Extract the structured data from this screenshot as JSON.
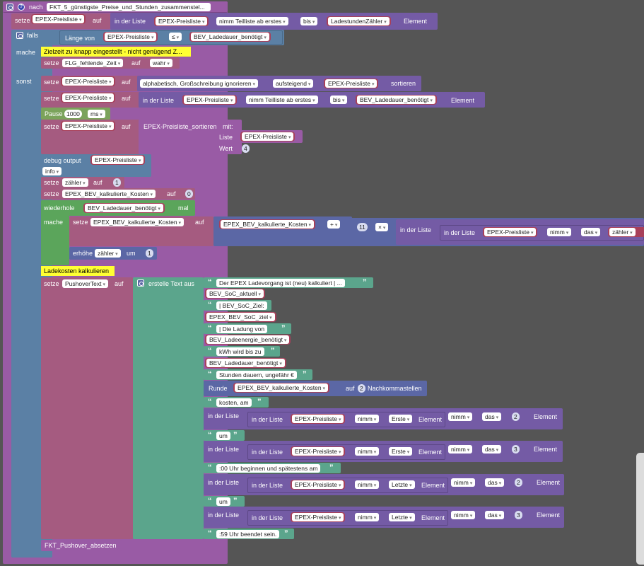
{
  "colors": {
    "canvas": "#555555",
    "function": "#995ba5",
    "variables": "#a55b80",
    "logic": "#5b80a5",
    "lists": "#745ba5",
    "text": "#5ba58c",
    "math": "#5b67a5",
    "loops": "#5ba55b",
    "timer": "#7ba35b",
    "comment": "#ffff33"
  },
  "header": {
    "kw_nach": "nach",
    "func_name": "FKT_5_günstigste_Preise_und_Stunden_zusammenstel..."
  },
  "set1": {
    "kw": "setze",
    "var": "EPEX-Preisliste",
    "kw_auf": "auf",
    "in_list": "in der Liste",
    "var2": "EPEX-Preisliste",
    "mode": "nimm Teilliste ab erstes",
    "kw_bis": "bis",
    "var3": "LadestundenZähler",
    "element": "Element"
  },
  "if": {
    "kw_falls": "falls",
    "kw_mache": "mache",
    "kw_sonst": "sonst",
    "length_of": "Länge von",
    "var": "EPEX-Preisliste",
    "op": "≤",
    "var2": "BEV_Ladedauer_benötigt",
    "comment": "Zielzeit zu knapp eingestellt - nicht genügend Z...",
    "set_kw": "setze",
    "set_var": "FLG_fehlende_Zeit",
    "set_auf": "auf",
    "set_val": "wahr"
  },
  "sort": {
    "kw": "setze",
    "var": "EPEX-Preisliste",
    "kw_auf": "auf",
    "mode": "alphabetisch, Großschreibung ignorieren",
    "order": "aufsteigend",
    "var2": "EPEX-Preisliste",
    "kw_sort": "sortieren"
  },
  "set2": {
    "kw": "setze",
    "var": "EPEX-Preisliste",
    "kw_auf": "auf",
    "in_list": "in der Liste",
    "var2": "EPEX-Preisliste",
    "mode": "nimm Teilliste ab erstes",
    "kw_bis": "bis",
    "var3": "BEV_Ladedauer_benötigt",
    "element": "Element"
  },
  "pause": {
    "kw": "Pause",
    "val": "1000",
    "unit": "ms"
  },
  "set3": {
    "kw": "setze",
    "var": "EPEX-Preisliste",
    "kw_auf": "auf",
    "func": "EPEX-Preisliste_sortieren",
    "kw_mit": "mit:",
    "lbl_liste": "Liste",
    "var2": "EPEX-Preisliste",
    "lbl_wert": "Wert",
    "val": "4"
  },
  "debug": {
    "kw": "debug output",
    "var": "EPEX-Preisliste",
    "level": "info"
  },
  "set4": {
    "kw": "setze",
    "var": "zähler",
    "kw_auf": "auf",
    "val": "1"
  },
  "set5": {
    "kw": "setze",
    "var": "EPEX_BEV_kalkulierte_Kosten",
    "kw_auf": "auf",
    "val": "0"
  },
  "loop": {
    "kw": "wiederhole",
    "var": "BEV_Ladedauer_benötigt",
    "kw_mal": "mal",
    "kw_mache": "mache",
    "set_kw": "setze",
    "set_var": "EPEX_BEV_kalkulierte_Kosten",
    "set_auf": "auf",
    "sum_var": "EPEX_BEV_kalkulierte_Kosten",
    "op_plus": "+",
    "num": "11",
    "op_mul": "×",
    "in_list": "in der Liste",
    "in_list2": "in der Liste",
    "list_var": "EPEX-Preisliste",
    "nimm": "nimm",
    "das": "das",
    "idx_var": "zähler",
    "inc_kw": "erhöhe",
    "inc_var": "zähler",
    "inc_um": "um",
    "inc_val": "1"
  },
  "comment2": "Ladekosten kalkulieren",
  "push": {
    "kw": "setze",
    "var": "PushoverText",
    "kw_auf": "auf",
    "create": "erstelle Text aus",
    "s1": "Der EPEX Ladevorgang ist (neu) kalkuliert | ...",
    "v1": "BEV_SoC_aktuell",
    "s2": "| BEV_SoC_Ziel:",
    "v2": "EPEX_BEV_SoC_ziel",
    "s3": "| Die Ladung von",
    "v3": "BEV_Ladeenergie_benötigt",
    "s4": "kWh wird bis zu",
    "v4": "BEV_Ladedauer_benötigt",
    "s5": "Stunden dauern, ungefähr €",
    "round": "Runde",
    "round_var": "EPEX_BEV_kalkulierte_Kosten",
    "round_auf": "auf",
    "round_n": "2",
    "round_tail": "Nachkommastellen",
    "s6": "kosten, am",
    "in_list": "in der Liste",
    "list_var": "EPEX-Preisliste",
    "nimm": "nimm",
    "first": "Erste",
    "last": "Letzte",
    "element": "Element",
    "das": "das",
    "n2": "2",
    "n3": "3",
    "s7": "um",
    "s8": ":00 Uhr beginnen und spätestens am",
    "s9": "um",
    "s10": ":59 Uhr beendet sein."
  },
  "call": "FKT_Pushover_absetzen"
}
